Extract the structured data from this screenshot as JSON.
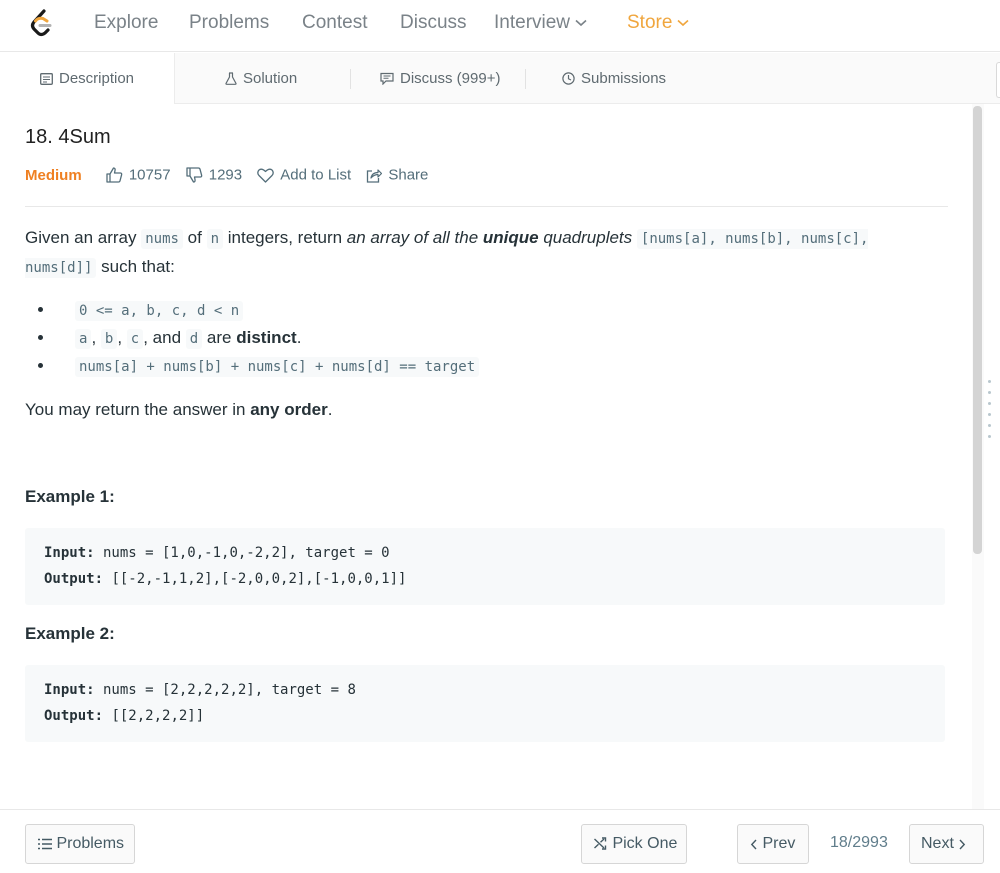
{
  "nav": {
    "items": [
      "Explore",
      "Problems",
      "Contest",
      "Discuss",
      "Interview",
      "Store"
    ]
  },
  "tabs": {
    "description": "Description",
    "solution": "Solution",
    "discuss": "Discuss (999+)",
    "submissions": "Submissions"
  },
  "problem": {
    "title": "18. 4Sum",
    "difficulty": "Medium",
    "likes": "10757",
    "dislikes": "1293",
    "add_to_list": "Add to List",
    "share": "Share",
    "intro_1": "Given an array ",
    "intro_code_nums": "nums",
    "intro_2": " of ",
    "intro_code_n": "n",
    "intro_3": " integers, return ",
    "intro_em_1": "an array of all the ",
    "intro_strong": "unique",
    "intro_em_2": " quadruplets ",
    "intro_code_quad": "[nums[a], nums[b], nums[c], nums[d]]",
    "intro_4": " such that:",
    "bullet_1_code": "0 <= a, b, c, d < n",
    "bullet_2_a": "a",
    "bullet_2_b": "b",
    "bullet_2_c": "c",
    "bullet_2_and": ", and ",
    "bullet_2_d": "d",
    "bullet_2_are": " are ",
    "bullet_2_distinct": "distinct",
    "bullet_3_code": "nums[a] + nums[b] + nums[c] + nums[d] == target",
    "closing_1": "You may return the answer in ",
    "closing_strong": "any order",
    "closing_2": "."
  },
  "examples": [
    {
      "title": "Example 1:",
      "input_label": "Input:",
      "input": " nums = [1,0,-1,0,-2,2], target = 0",
      "output_label": "Output:",
      "output": " [[-2,-1,1,2],[-2,0,0,2],[-1,0,0,1]]"
    },
    {
      "title": "Example 2:",
      "input_label": "Input:",
      "input": " nums = [2,2,2,2,2], target = 8",
      "output_label": "Output:",
      "output": " [[2,2,2,2]]"
    }
  ],
  "bottom": {
    "problems": "Problems",
    "pick_one": "Pick One",
    "prev": "Prev",
    "page": "18/2993",
    "next": "Next"
  },
  "colors": {
    "difficulty": "#ef8022",
    "store": "#f0a63e"
  }
}
